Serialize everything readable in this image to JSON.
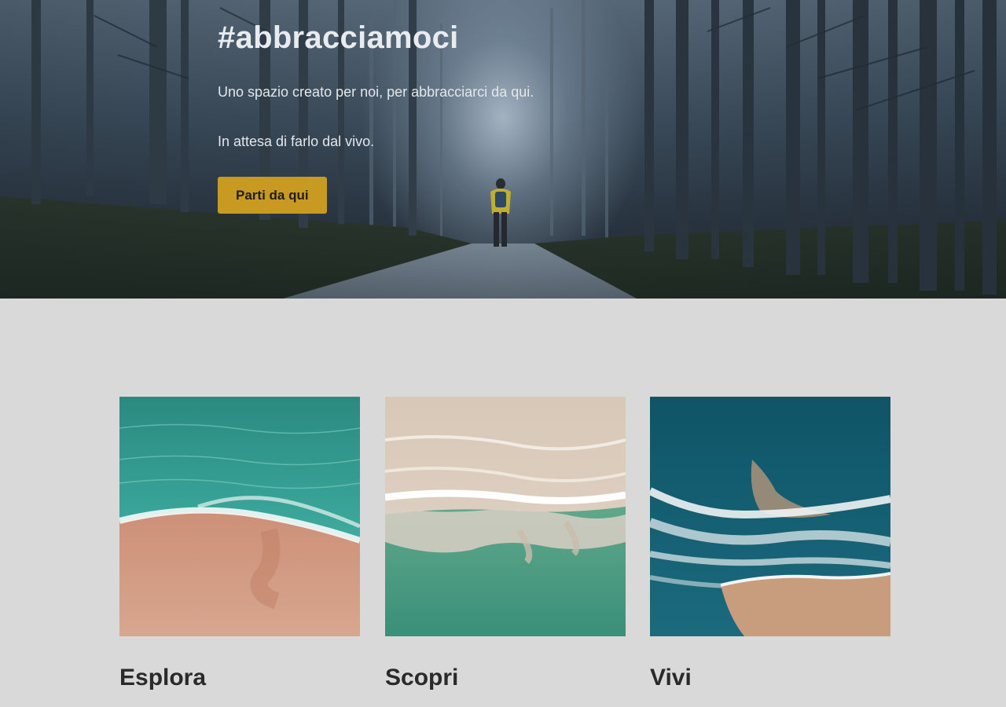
{
  "hero": {
    "title": "#abbracciamoci",
    "line1": "Uno spazio creato per noi, per abbracciarci da qui.",
    "line2": "In attesa di farlo dal vivo.",
    "button_label": "Parti da qui",
    "button_color": "#c99a22"
  },
  "cards": [
    {
      "title": "Esplora",
      "image": "aerial-beach-teal-sand"
    },
    {
      "title": "Scopri",
      "image": "aerial-sand-wave-green-sea"
    },
    {
      "title": "Vivi",
      "image": "aerial-deep-blue-sea-waves"
    }
  ],
  "colors": {
    "page_background": "#d9d9d9",
    "title_text": "#2a2a2a"
  }
}
